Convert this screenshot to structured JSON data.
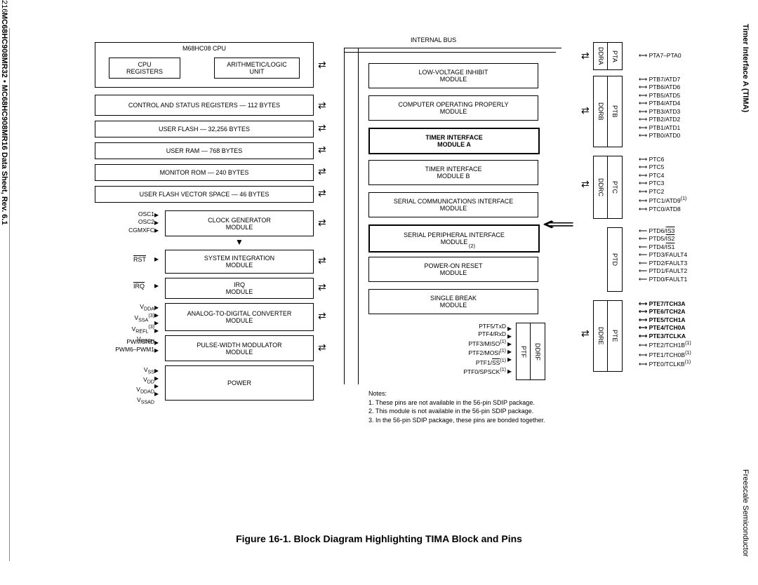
{
  "page_number": "216",
  "datasheet": "MC68HC908MR32 • MC68HC908MR16 Data Sheet, Rev. 6.1",
  "header_right": "Timer Interface A (TIMA)",
  "footer_right": "Freescale Semiconductor",
  "caption": "Figure 16-1. Block Diagram Highlighting TIMA Block and Pins",
  "cpu": {
    "title": "M68HC08 CPU",
    "regs": "CPU\nREGISTERS",
    "alu": "ARITHMETIC/LOGIC\nUNIT"
  },
  "left_blocks": [
    "CONTROL AND STATUS REGISTERS — 112 BYTES",
    "USER FLASH — 32,256 BYTES",
    "USER RAM — 768 BYTES",
    "MONITOR ROM — 240 BYTES",
    "USER FLASH VECTOR SPACE — 46 BYTES",
    "CLOCK GENERATOR\nMODULE",
    "SYSTEM INTEGRATION\nMODULE",
    "IRQ\nMODULE",
    "ANALOG-TO-DIGITAL CONVERTER\nMODULE",
    "PULSE-WIDTH MODULATOR\nMODULE",
    "POWER"
  ],
  "left_pins": {
    "clock": [
      "OSC1",
      "OSC2",
      "CGMXFC"
    ],
    "sim": "RST",
    "irq": "IRQ",
    "adc": [
      "VDDA",
      "VSSA",
      "VREFL",
      "VREFH"
    ],
    "pwm": [
      "PWMGND",
      "PWM6–PWM1"
    ],
    "power": [
      "VSS",
      "VDD",
      "VDDAD",
      "VSSAD"
    ],
    "sup_adc": "(3)"
  },
  "bus": {
    "label": "INTERNAL BUS"
  },
  "center_blocks": [
    "LOW-VOLTAGE INHIBIT\nMODULE",
    "COMPUTER OPERATING PROPERLY\nMODULE",
    "TIMER INTERFACE\nMODULE A",
    "TIMER INTERFACE\nMODULE B",
    "SERIAL COMMUNICATIONS INTERFACE\nMODULE",
    "SERIAL PERIPHERAL INTERFACE\nMODULE",
    "POWER-ON RESET\nMODULE",
    "SINGLE BREAK\nMODULE"
  ],
  "spi_note": "(2)",
  "ptf": {
    "ddrf": "DDRF",
    "ptf": "PTF",
    "pins": [
      "PTF5/TxD",
      "PTF4/RxD",
      "PTF3/MISO",
      "PTF2/MOSI",
      "PTF1/SS",
      "PTF0/SPSCK"
    ],
    "sup": "(1)"
  },
  "ports": {
    "ddra": "DDRA",
    "pta": "PTA",
    "ddrb": "DDRB",
    "ptb": "PTB",
    "ddrc": "DDRC",
    "ptc": "PTC",
    "ptd": "PTD",
    "ddre": "DDRE",
    "pte": "PTE"
  },
  "pta_pins": [
    "PTA7–PTA0"
  ],
  "ptb_pins": [
    "PTB7/ATD7",
    "PTB6/ATD6",
    "PTB5/ATD5",
    "PTB4/ATD4",
    "PTB3/ATD3",
    "PTB2/ATD2",
    "PTB1/ATD1",
    "PTB0/ATD0"
  ],
  "ptc_pins": [
    "PTC6",
    "PTC5",
    "PTC4",
    "PTC3",
    "PTC2",
    "PTC1/ATD9",
    "PTC0/ATD8"
  ],
  "ptc_sup": "(1)",
  "ptd_pins_top": [
    "PTD6/IS3",
    "PTD5/IS2",
    "PTD4/IS1"
  ],
  "ptd_pins_bot": [
    "PTD3/FAULT4",
    "PTD2/FAULT3",
    "PTD1/FAULT2",
    "PTD0/FAULT1"
  ],
  "pte_pins_bold": [
    "PTE7/TCH3A",
    "PTE6/TCH2A",
    "PTE5/TCH1A",
    "PTE4/TCH0A",
    "PTE3/TCLKA"
  ],
  "pte_pins_rest": [
    "PTE2/TCH1B",
    "PTE1/TCH0B",
    "PTE0/TCLKB"
  ],
  "pte_sup": "(1)",
  "notes": {
    "title": "Notes:",
    "n1": "1. These pins are not available in the 56-pin SDIP package.",
    "n2": "2. This module is not available in the 56-pin SDIP package.",
    "n3": "3. In the 56-pin SDIP package, these pins are bonded together."
  }
}
